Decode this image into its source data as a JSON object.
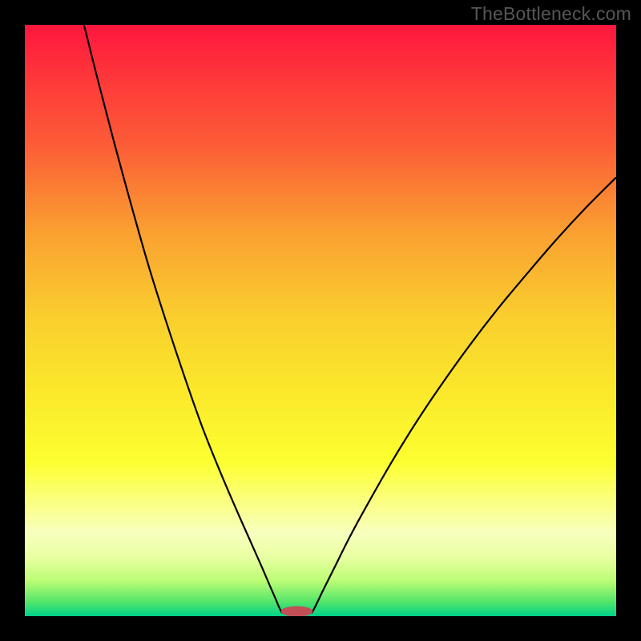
{
  "watermark": "TheBottleneck.com",
  "chart_data": {
    "type": "line",
    "title": "",
    "xlabel": "",
    "ylabel": "",
    "xlim": [
      0,
      100
    ],
    "ylim": [
      0,
      100
    ],
    "background_gradient": {
      "stops": [
        {
          "offset": 0.0,
          "color": "#fe163d"
        },
        {
          "offset": 0.1,
          "color": "#fe3b3a"
        },
        {
          "offset": 0.2,
          "color": "#fc5b37"
        },
        {
          "offset": 0.35,
          "color": "#faa031"
        },
        {
          "offset": 0.5,
          "color": "#fad02e"
        },
        {
          "offset": 0.62,
          "color": "#fbe82b"
        },
        {
          "offset": 0.74,
          "color": "#fcff30"
        },
        {
          "offset": 0.8,
          "color": "#fbff7a"
        },
        {
          "offset": 0.86,
          "color": "#f7ffbe"
        },
        {
          "offset": 0.9,
          "color": "#e9ffa2"
        },
        {
          "offset": 0.94,
          "color": "#bcfd75"
        },
        {
          "offset": 0.975,
          "color": "#56e66a"
        },
        {
          "offset": 1.0,
          "color": "#00d289"
        }
      ]
    },
    "series": [
      {
        "name": "left-curve",
        "color": "#000000",
        "points": [
          {
            "x": 10.0,
            "y": 100.0
          },
          {
            "x": 12.0,
            "y": 92.0
          },
          {
            "x": 15.0,
            "y": 80.5
          },
          {
            "x": 18.0,
            "y": 69.5
          },
          {
            "x": 21.0,
            "y": 59.0
          },
          {
            "x": 24.0,
            "y": 49.5
          },
          {
            "x": 27.0,
            "y": 40.5
          },
          {
            "x": 30.0,
            "y": 32.0
          },
          {
            "x": 33.0,
            "y": 24.5
          },
          {
            "x": 36.0,
            "y": 17.5
          },
          {
            "x": 38.0,
            "y": 13.0
          },
          {
            "x": 40.0,
            "y": 8.5
          },
          {
            "x": 41.5,
            "y": 5.0
          },
          {
            "x": 42.5,
            "y": 2.7
          },
          {
            "x": 43.0,
            "y": 1.5
          },
          {
            "x": 43.5,
            "y": 0.5
          }
        ]
      },
      {
        "name": "right-curve",
        "color": "#000000",
        "points": [
          {
            "x": 48.5,
            "y": 0.5
          },
          {
            "x": 49.2,
            "y": 1.8
          },
          {
            "x": 50.5,
            "y": 4.5
          },
          {
            "x": 52.5,
            "y": 8.5
          },
          {
            "x": 55.0,
            "y": 13.5
          },
          {
            "x": 58.0,
            "y": 19.0
          },
          {
            "x": 62.0,
            "y": 26.0
          },
          {
            "x": 66.0,
            "y": 32.5
          },
          {
            "x": 70.0,
            "y": 38.5
          },
          {
            "x": 75.0,
            "y": 45.5
          },
          {
            "x": 80.0,
            "y": 52.0
          },
          {
            "x": 85.0,
            "y": 58.0
          },
          {
            "x": 90.0,
            "y": 63.8
          },
          {
            "x": 95.0,
            "y": 69.2
          },
          {
            "x": 100.0,
            "y": 74.2
          }
        ]
      }
    ],
    "marker": {
      "name": "bottom-marker",
      "cx": 46.0,
      "cy": 0.8,
      "rx": 2.7,
      "ry": 0.9,
      "fill": "#c14f55"
    }
  }
}
